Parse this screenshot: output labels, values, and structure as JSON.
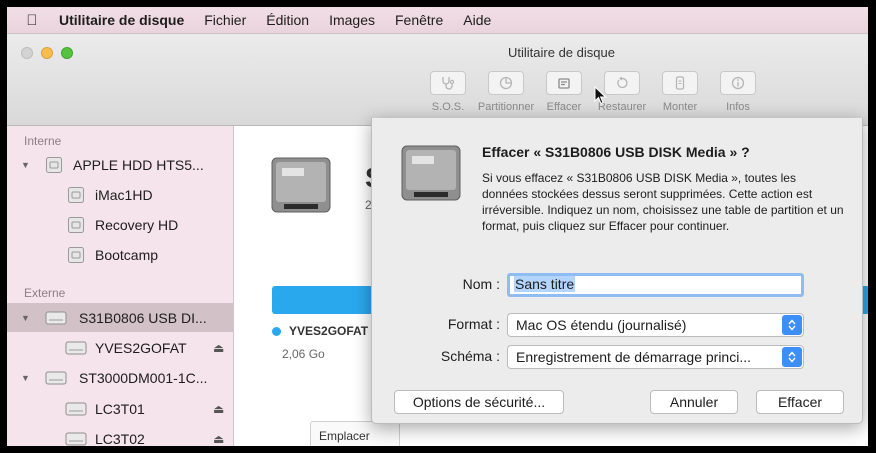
{
  "menubar": {
    "app_name": "Utilitaire de disque",
    "items": [
      "Fichier",
      "Édition",
      "Images",
      "Fenêtre",
      "Aide"
    ]
  },
  "window": {
    "title": "Utilitaire de disque"
  },
  "toolbar": {
    "items": [
      {
        "label": "S.O.S.",
        "icon": "stethoscope-icon"
      },
      {
        "label": "Partitionner",
        "icon": "pie-chart-icon"
      },
      {
        "label": "Effacer",
        "icon": "erase-icon"
      },
      {
        "label": "Restaurer",
        "icon": "restore-icon"
      },
      {
        "label": "Monter",
        "icon": "mount-icon"
      },
      {
        "label": "Infos",
        "icon": "info-icon"
      }
    ]
  },
  "sidebar": {
    "internal_label": "Interne",
    "external_label": "Externe",
    "internal": [
      {
        "label": "APPLE HDD HTS5...",
        "level": 0
      },
      {
        "label": "iMac1HD",
        "level": 1
      },
      {
        "label": "Recovery HD",
        "level": 1
      },
      {
        "label": "Bootcamp",
        "level": 1
      }
    ],
    "external": [
      {
        "label": "S31B0806 USB DI...",
        "level": 0,
        "selected": true
      },
      {
        "label": "YVES2GOFAT",
        "level": 1,
        "eject": true
      },
      {
        "label": "ST3000DM001-1C...",
        "level": 0
      },
      {
        "label": "LC3T01",
        "level": 1,
        "eject": true
      },
      {
        "label": "LC3T02",
        "level": 1,
        "eject": true
      }
    ]
  },
  "main": {
    "title_peek": "S",
    "subtitle_peek": "2",
    "volume_name": "YVES2GOFAT",
    "volume_size": "2,06 Go",
    "tab_peek": "Emplacer",
    "accent_color": "#2aa8ee"
  },
  "dialog": {
    "title": "Effacer « S31B0806 USB DISK Media » ?",
    "message": "Si vous effacez « S31B0806 USB DISK Media », toutes les données stockées dessus seront supprimées. Cette action est irréversible. Indiquez un nom, choisissez une table de partition et un format, puis cliquez sur Effacer pour continuer.",
    "name_label": "Nom :",
    "name_value": "Sans titre",
    "format_label": "Format :",
    "format_value": "Mac OS étendu (journalisé)",
    "scheme_label": "Schéma :",
    "scheme_value": "Enregistrement de démarrage princi...",
    "security_button": "Options de sécurité...",
    "cancel_button": "Annuler",
    "erase_button": "Effacer"
  }
}
